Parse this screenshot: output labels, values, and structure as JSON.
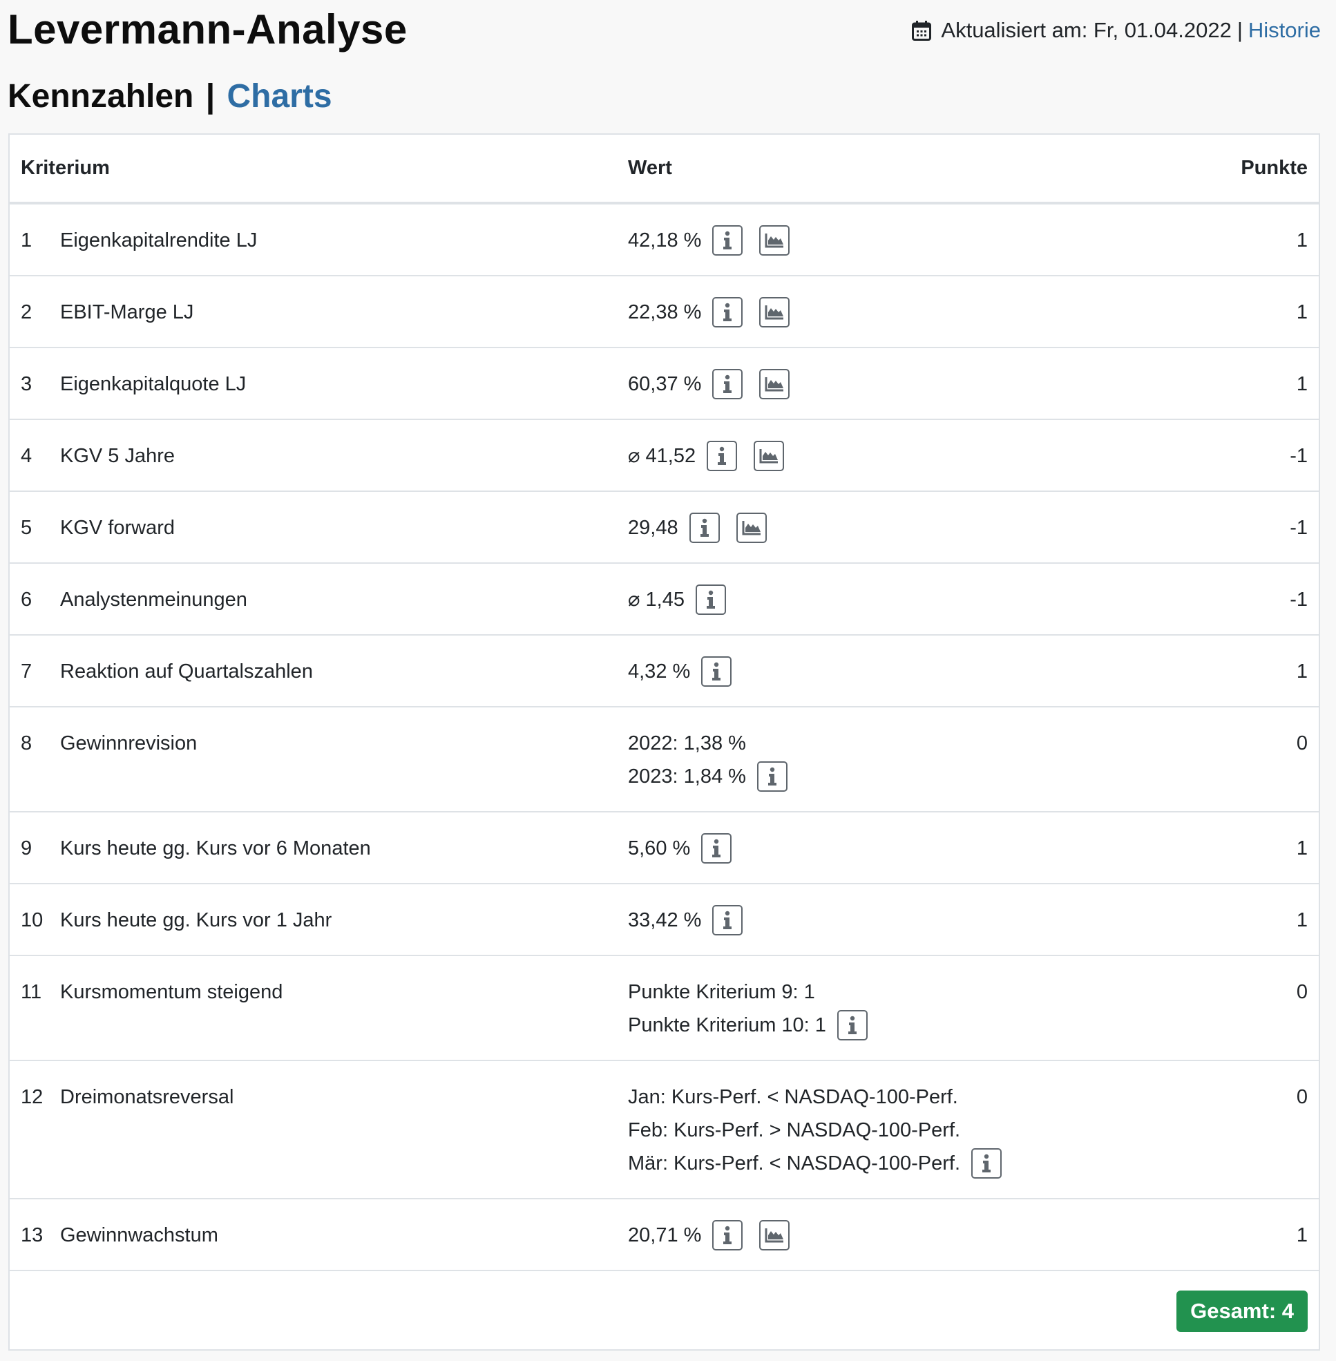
{
  "header": {
    "title": "Levermann-Analyse",
    "updated_label": "Aktualisiert am: Fr, 01.04.2022",
    "separator": "|",
    "history_link": "Historie",
    "calendar_icon": "calendar-icon"
  },
  "subheader": {
    "tab_active": "Kennzahlen",
    "separator": "|",
    "tab_link": "Charts",
    "link_color": "#2e6da4"
  },
  "table": {
    "columns": [
      "Kriterium",
      "Wert",
      "Punkte"
    ],
    "rows": [
      {
        "num": "1",
        "label": "Eigenkapitalrendite LJ",
        "value_lines": [
          "42,18 %"
        ],
        "info": true,
        "chart": true,
        "points": "1"
      },
      {
        "num": "2",
        "label": "EBIT-Marge LJ",
        "value_lines": [
          "22,38 %"
        ],
        "info": true,
        "chart": true,
        "points": "1"
      },
      {
        "num": "3",
        "label": "Eigenkapitalquote LJ",
        "value_lines": [
          "60,37 %"
        ],
        "info": true,
        "chart": true,
        "points": "1"
      },
      {
        "num": "4",
        "label": "KGV 5 Jahre",
        "value_lines": [
          "⌀ 41,52"
        ],
        "info": true,
        "chart": true,
        "points": "-1"
      },
      {
        "num": "5",
        "label": "KGV forward",
        "value_lines": [
          "29,48"
        ],
        "info": true,
        "chart": true,
        "points": "-1"
      },
      {
        "num": "6",
        "label": "Analystenmeinungen",
        "value_lines": [
          "⌀ 1,45"
        ],
        "info": true,
        "chart": false,
        "points": "-1"
      },
      {
        "num": "7",
        "label": "Reaktion auf Quartalszahlen",
        "value_lines": [
          "4,32 %"
        ],
        "info": true,
        "chart": false,
        "points": "1"
      },
      {
        "num": "8",
        "label": "Gewinnrevision",
        "value_lines": [
          "2022: 1,38 %",
          "2023: 1,84 %"
        ],
        "info": true,
        "chart": false,
        "points": "0"
      },
      {
        "num": "9",
        "label": "Kurs heute gg. Kurs vor 6 Monaten",
        "value_lines": [
          "5,60 %"
        ],
        "info": true,
        "chart": false,
        "points": "1"
      },
      {
        "num": "10",
        "label": "Kurs heute gg. Kurs vor 1 Jahr",
        "value_lines": [
          "33,42 %"
        ],
        "info": true,
        "chart": false,
        "points": "1"
      },
      {
        "num": "11",
        "label": "Kursmomentum steigend",
        "value_lines": [
          "Punkte Kriterium 9: 1",
          "Punkte Kriterium 10: 1"
        ],
        "info": true,
        "chart": false,
        "points": "0"
      },
      {
        "num": "12",
        "label": "Dreimonatsreversal",
        "value_lines": [
          "Jan: Kurs-Perf. < NASDAQ-100-Perf.",
          "Feb: Kurs-Perf. > NASDAQ-100-Perf.",
          "Mär: Kurs-Perf. < NASDAQ-100-Perf."
        ],
        "info": true,
        "chart": false,
        "points": "0"
      },
      {
        "num": "13",
        "label": "Gewinnwachstum",
        "value_lines": [
          "20,71 %"
        ],
        "info": true,
        "chart": true,
        "points": "1"
      }
    ],
    "total_label": "Gesamt: 4",
    "total_color": "#22924f",
    "info_icon": "info-icon",
    "chart_icon": "area-chart-icon"
  }
}
